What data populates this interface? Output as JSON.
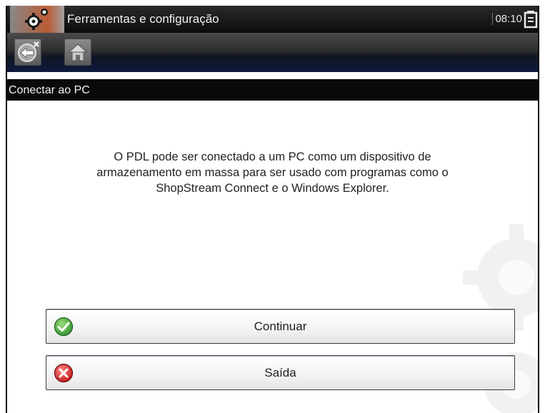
{
  "titlebar": {
    "title": "Ferramentas e configuração",
    "time": "08:10",
    "app_icon": "gear-icon",
    "battery_icon": "battery-icon"
  },
  "toolbar": {
    "back_icon": "back-icon",
    "home_icon": "home-icon"
  },
  "breadcrumb": {
    "text": "Conectar ao PC"
  },
  "main": {
    "message_lines": [
      "O PDL pode ser conectado a um PC como um dispositivo de",
      "armazenamento em massa para ser usado com programas como o",
      "ShopStream Connect e o Windows Explorer."
    ]
  },
  "buttons": {
    "continue_label": "Continuar",
    "exit_label": "Saída",
    "continue_icon": "check-icon",
    "exit_icon": "x-icon"
  },
  "colors": {
    "check_green": "#3aa63a",
    "exit_red": "#d42020",
    "header_dark": "#0a0a0a",
    "toolbar_blue": "#0e1a40"
  }
}
